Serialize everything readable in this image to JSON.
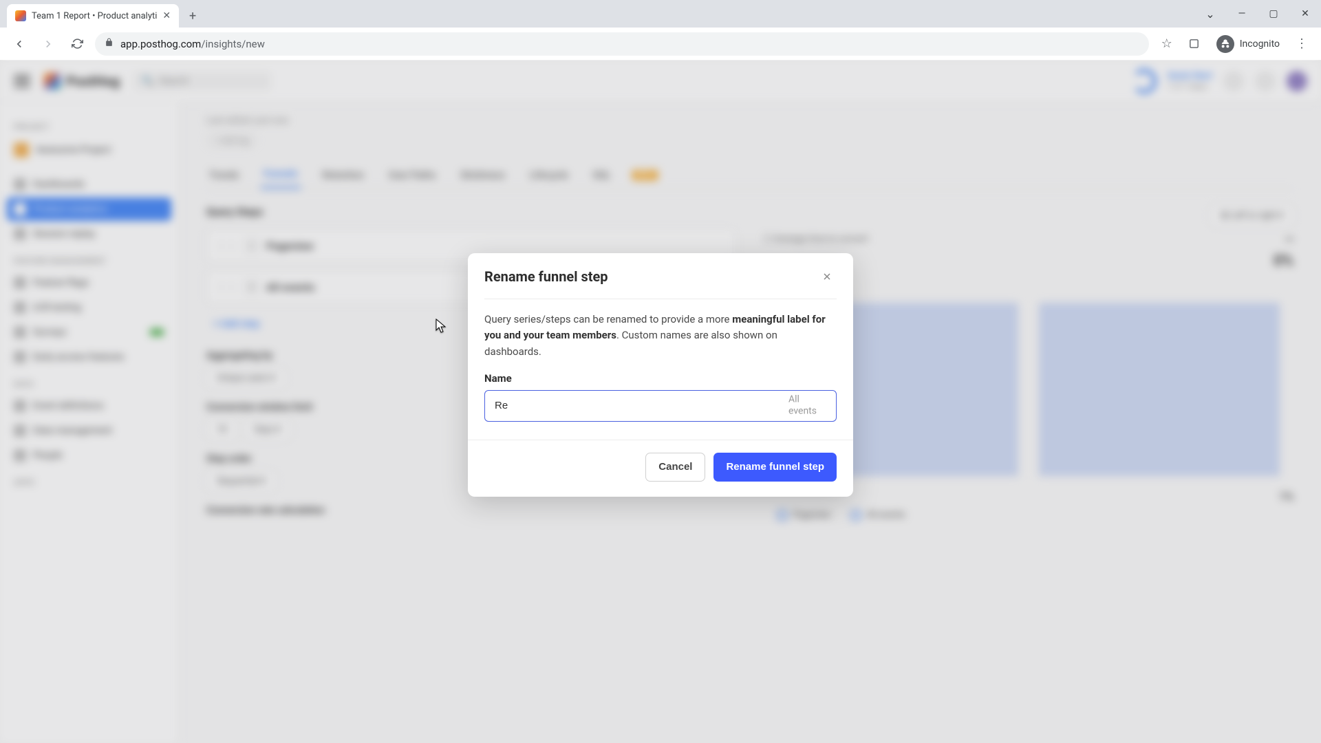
{
  "browser": {
    "tab_title": "Team 1 Report • Product analyti",
    "url_host": "app.posthog.com",
    "url_path": "/insights/new",
    "incognito_label": "Incognito"
  },
  "app": {
    "logo": "PostHog",
    "search_placeholder": "Search",
    "header_link": "Quick Start",
    "header_sub": "1 of 7 steps"
  },
  "sidebar": {
    "section_project": "PROJECT",
    "project_name": "Awesome Project",
    "items_main": [
      "Dashboards",
      "Product analytics",
      "Session replay"
    ],
    "section_feature": "FEATURE MANAGEMENT",
    "items_feature": [
      "Feature flags",
      "A/B testing",
      "Surveys",
      "Early access features"
    ],
    "section_data": "DATA",
    "items_data": [
      "Event definitions",
      "Data management",
      "People"
    ],
    "section_apps": "APPS"
  },
  "main": {
    "breadcrumb": "Last edited: just now",
    "add_tag": "+ Add tag",
    "tabs": [
      "Trends",
      "Funnels",
      "Retention",
      "User Paths",
      "Stickiness",
      "Lifecycle",
      "SQL"
    ],
    "beta": "BETA",
    "section_steps": "Query Steps",
    "step_a": "Pageview",
    "step_b": "All events",
    "add_step": "+ Add step",
    "aggregating": "Aggregating by",
    "conv_window": "Conversion window limit",
    "step_order": "Step order",
    "step_order_val": "Sequential",
    "conv_rate": "Conversion rate calculation",
    "days_val": "Days",
    "num_14": "14",
    "graph_type": "Left to right",
    "avg_time": "Average time to convert",
    "pct_0": "0%",
    "pct_1": "1%",
    "leg_a": "Pageview",
    "leg_b": "All events"
  },
  "modal": {
    "title": "Rename funnel step",
    "desc_1": "Query series/steps can be renamed to provide a more ",
    "desc_bold": "meaningful label for you and your team members",
    "desc_2": ". Custom names are also shown on dashboards.",
    "label": "Name",
    "input_value": "Re",
    "input_placeholder": "All events",
    "cancel": "Cancel",
    "confirm": "Rename funnel step"
  }
}
